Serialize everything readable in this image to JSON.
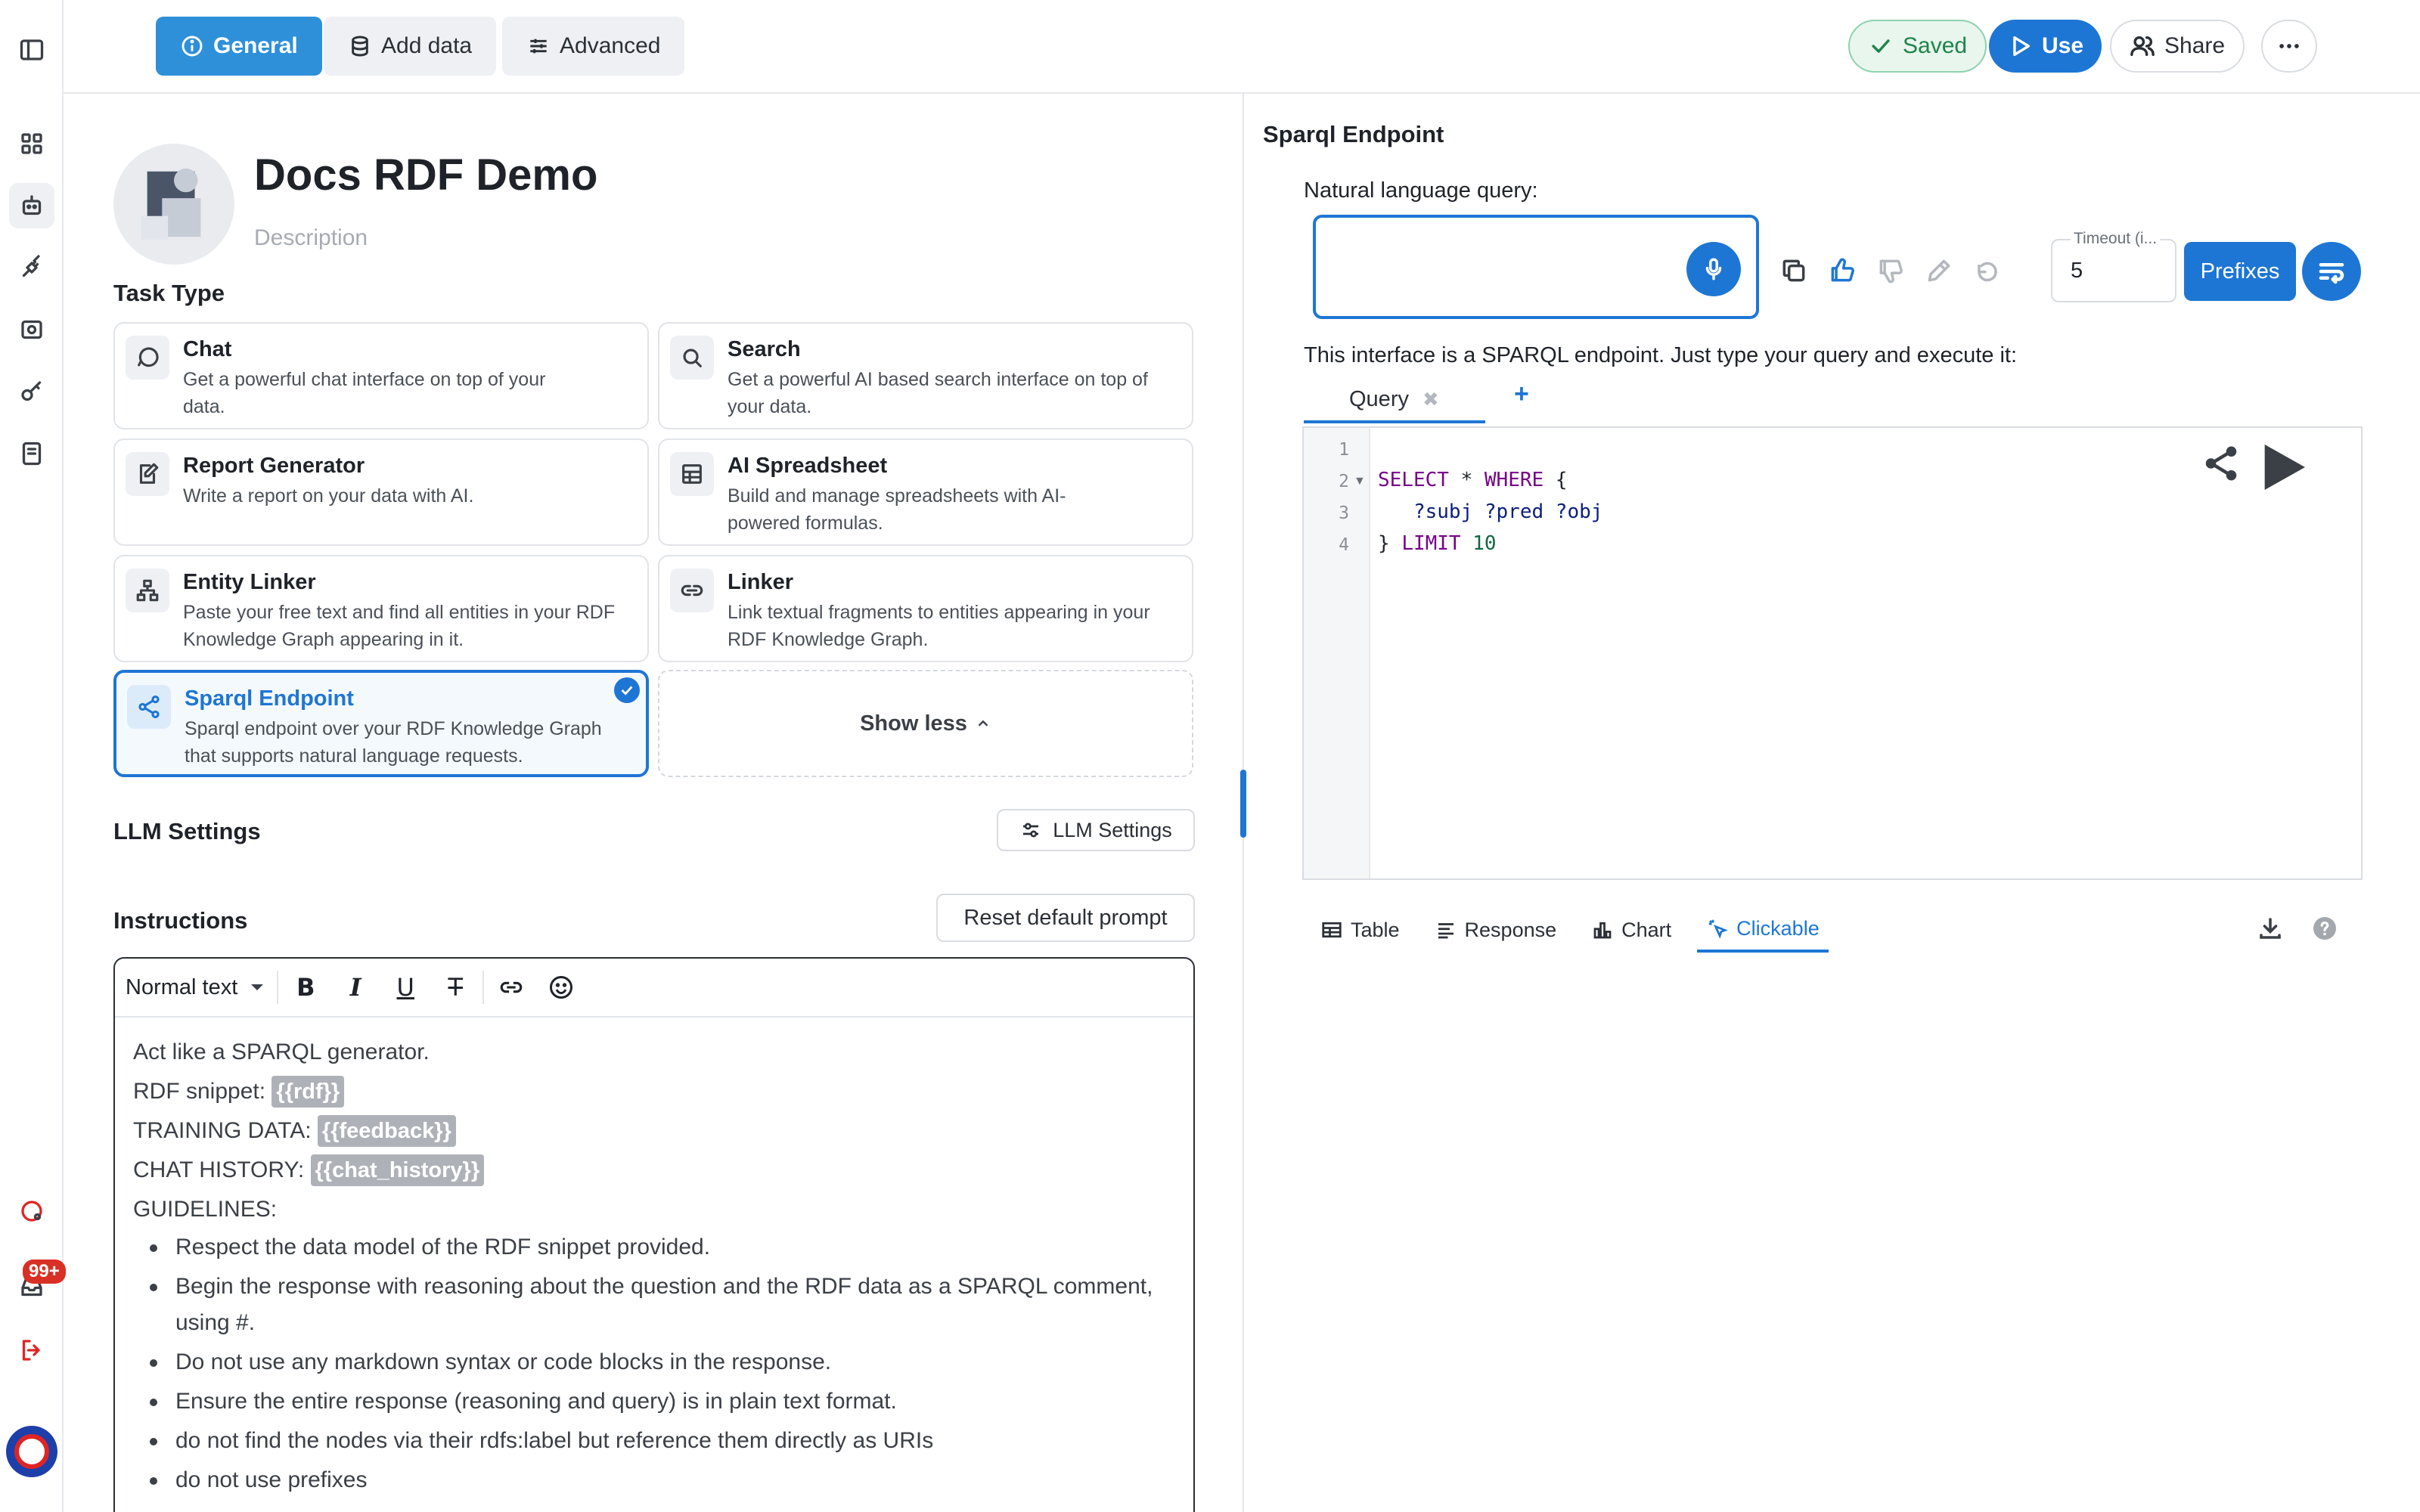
{
  "topbar": {
    "tabs": [
      {
        "label": "General",
        "icon": "info-icon",
        "active": true
      },
      {
        "label": "Add data",
        "icon": "database-icon",
        "active": false
      },
      {
        "label": "Advanced",
        "icon": "sliders-icon",
        "active": false
      }
    ],
    "saved_label": "Saved",
    "use_label": "Use",
    "share_label": "Share"
  },
  "app": {
    "title": "Docs RDF Demo",
    "description_placeholder": "Description"
  },
  "task_type": {
    "label": "Task Type",
    "items": [
      {
        "title": "Chat",
        "desc": "Get a powerful chat interface on top of your data.",
        "icon": "chat-bubble-icon"
      },
      {
        "title": "Search",
        "desc": "Get a powerful AI based search interface on top of your data.",
        "icon": "search-icon"
      },
      {
        "title": "Report Generator",
        "desc": "Write a report on your data with AI.",
        "icon": "report-edit-icon"
      },
      {
        "title": "AI Spreadsheet",
        "desc": "Build and manage spreadsheets with AI-powered formulas.",
        "icon": "table-icon"
      },
      {
        "title": "Entity Linker",
        "desc": "Paste your free text and find all entities in your RDF Knowledge Graph appearing in it.",
        "icon": "hierarchy-icon"
      },
      {
        "title": "Linker",
        "desc": "Link textual fragments to entities appearing in your RDF Knowledge Graph.",
        "icon": "link-icon"
      },
      {
        "title": "Sparql Endpoint",
        "desc": "Sparql endpoint over your RDF Knowledge Graph that supports natural language requests.",
        "icon": "share-nodes-icon",
        "selected": true
      }
    ],
    "show_less_label": "Show less"
  },
  "llm": {
    "section_label": "LLM Settings",
    "button_label": "LLM Settings"
  },
  "instructions": {
    "label": "Instructions",
    "reset_label": "Reset default prompt",
    "format_select": "Normal text",
    "lines": [
      {
        "text": "Act like a SPARQL generator.",
        "chip": ""
      },
      {
        "text": "RDF snippet: ",
        "chip": "{{rdf}}"
      },
      {
        "text": "TRAINING DATA: ",
        "chip": "{{feedback}}"
      },
      {
        "text": "CHAT HISTORY: ",
        "chip": "{{chat_history}}"
      },
      {
        "text": "GUIDELINES:",
        "chip": ""
      }
    ],
    "bullets": [
      "Respect the data model of the RDF snippet provided.",
      "Begin the response with reasoning about the question and the RDF data as a SPARQL comment, using #.",
      "Do not use any markdown syntax or code blocks in the response.",
      "Ensure the entire response (reasoning and query) is in plain text format.",
      "do not find the nodes via their rdfs:label but reference them directly as URIs",
      "do not use prefixes"
    ]
  },
  "sparql": {
    "title": "Sparql Endpoint",
    "nl_label": "Natural language query:",
    "timeout_label": "Timeout (i...",
    "timeout_value": "5",
    "prefixes_label": "Prefixes",
    "help_text": "This interface is a SPARQL endpoint. Just type your query and execute it:",
    "query_tab": "Query",
    "query_tab_close": "✖",
    "add_tab": "+",
    "line_numbers": [
      "1",
      "2",
      "3",
      "4"
    ],
    "code": {
      "l2_kw1": "SELECT",
      "l2_rest": " * ",
      "l2_kw2": "WHERE",
      "l2_brace": " {",
      "l3": "   ?subj ?pred ?obj",
      "l4_brace": "} ",
      "l4_kw": "LIMIT",
      "l4_num": " 10"
    },
    "result_tabs": [
      {
        "label": "Table",
        "icon": "table-icon"
      },
      {
        "label": "Response",
        "icon": "lines-icon"
      },
      {
        "label": "Chart",
        "icon": "bar-chart-icon"
      },
      {
        "label": "Clickable",
        "icon": "cursor-click-icon",
        "active": true
      }
    ]
  },
  "rail": {
    "badge": "99+"
  },
  "colors": {
    "accent": "#1e76d4",
    "general_tab": "#2e90d9",
    "saved_green": "#1e8449"
  }
}
